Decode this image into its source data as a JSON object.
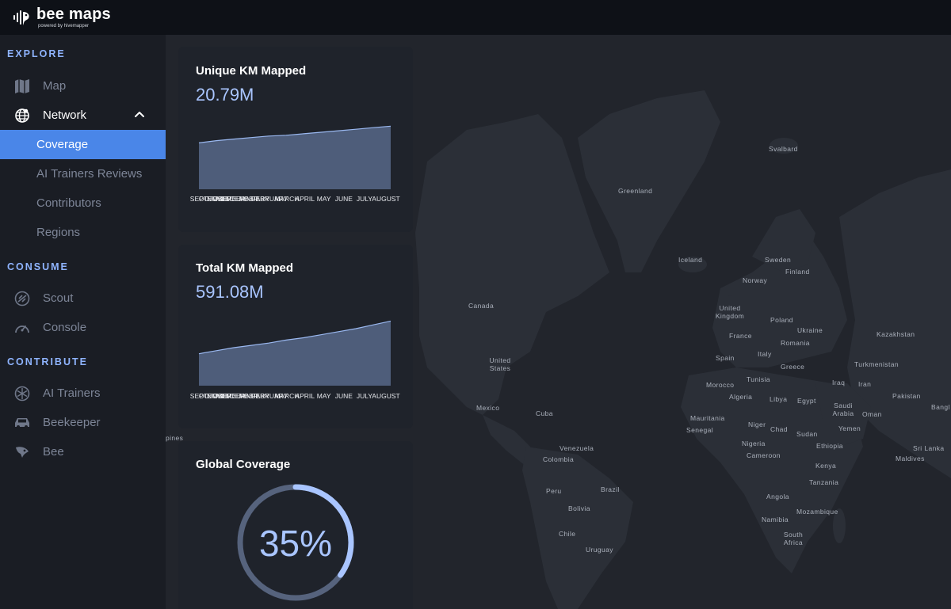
{
  "brand": {
    "name": "bee maps",
    "tagline": "powered by hivemapper"
  },
  "sidebar": {
    "sections": [
      {
        "title": "EXPLORE"
      },
      {
        "title": "CONSUME"
      },
      {
        "title": "CONTRIBUTE"
      }
    ],
    "items": {
      "map": {
        "label": "Map",
        "icon": "map-icon"
      },
      "network": {
        "label": "Network",
        "icon": "globe-icon",
        "expanded": true
      },
      "coverage": {
        "label": "Coverage",
        "active": true
      },
      "ai_reviews": {
        "label": "AI Trainers Reviews"
      },
      "contributors": {
        "label": "Contributors"
      },
      "regions": {
        "label": "Regions"
      },
      "scout": {
        "label": "Scout",
        "icon": "scout-icon"
      },
      "console": {
        "label": "Console",
        "icon": "gauge-icon"
      },
      "ai_trainers": {
        "label": "AI Trainers",
        "icon": "ai-trainers-icon"
      },
      "beekeeper": {
        "label": "Beekeeper",
        "icon": "car-icon"
      },
      "bee": {
        "label": "Bee",
        "icon": "bee-device-icon"
      }
    },
    "active_color": "#4a86e8"
  },
  "cards": {
    "unique": {
      "title": "Unique KM Mapped",
      "value": "20.79M"
    },
    "total": {
      "title": "Total KM Mapped",
      "value": "591.08M"
    },
    "coverage": {
      "title": "Global Coverage",
      "value": "35%",
      "fraction": 0.35
    }
  },
  "chart_data": [
    {
      "type": "area",
      "categories": [
        "SEPTEMBER",
        "OCTOBER",
        "NOVEMBER",
        "DECEMBER",
        "JANUARY",
        "FEBRUARY",
        "MARCH",
        "APRIL",
        "MAY",
        "JUNE",
        "JULY",
        "AUGUST"
      ],
      "values": [
        0.61,
        0.64,
        0.66,
        0.68,
        0.7,
        0.71,
        0.73,
        0.75,
        0.77,
        0.79,
        0.81,
        0.83
      ],
      "title": "Unique KM Mapped",
      "ylim": [
        0,
        1
      ]
    },
    {
      "type": "area",
      "categories": [
        "SEPTEMBER",
        "OCTOBER",
        "NOVEMBER",
        "DECEMBER",
        "JANUARY",
        "FEBRUARY",
        "MARCH",
        "APRIL",
        "MAY",
        "JUNE",
        "JULY",
        "AUGUST"
      ],
      "values": [
        0.42,
        0.46,
        0.5,
        0.53,
        0.56,
        0.6,
        0.63,
        0.67,
        0.71,
        0.75,
        0.8,
        0.85
      ],
      "title": "Total KM Mapped",
      "ylim": [
        0,
        1
      ]
    }
  ],
  "map_labels": [
    "Svalbard",
    "Greenland",
    "Iceland",
    "Sweden",
    "Norway",
    "Finland",
    "Canada",
    "United Kingdom",
    "Poland",
    "Ukraine",
    "Kazakhstan",
    "France",
    "Romania",
    "Italy",
    "Spain",
    "Greece",
    "Turkmenistan",
    "United States",
    "Tunisia",
    "Morocco",
    "Algeria",
    "Libya",
    "Egypt",
    "Iraq",
    "Iran",
    "Saudi Arabia",
    "Pakistan",
    "Oman",
    "Mexico",
    "Cuba",
    "Mauritania",
    "Senegal",
    "Niger",
    "Chad",
    "Sudan",
    "Yemen",
    "Venezuela",
    "Colombia",
    "Nigeria",
    "Cameroon",
    "Ethiopia",
    "Sri Lanka",
    "Maldives",
    "Kenya",
    "Tanzania",
    "Peru",
    "Brazil",
    "Bolivia",
    "Angola",
    "Mozambique",
    "Namibia",
    "Chile",
    "South Africa",
    "Uruguay",
    "pines",
    "Bangl"
  ],
  "colors": {
    "accent": "#8fb4ff",
    "chart_fill": "#4e5d7a",
    "chart_line": "#9ab8f0",
    "ring_track": "#56637d",
    "ring_progress": "#a9c5ff"
  }
}
